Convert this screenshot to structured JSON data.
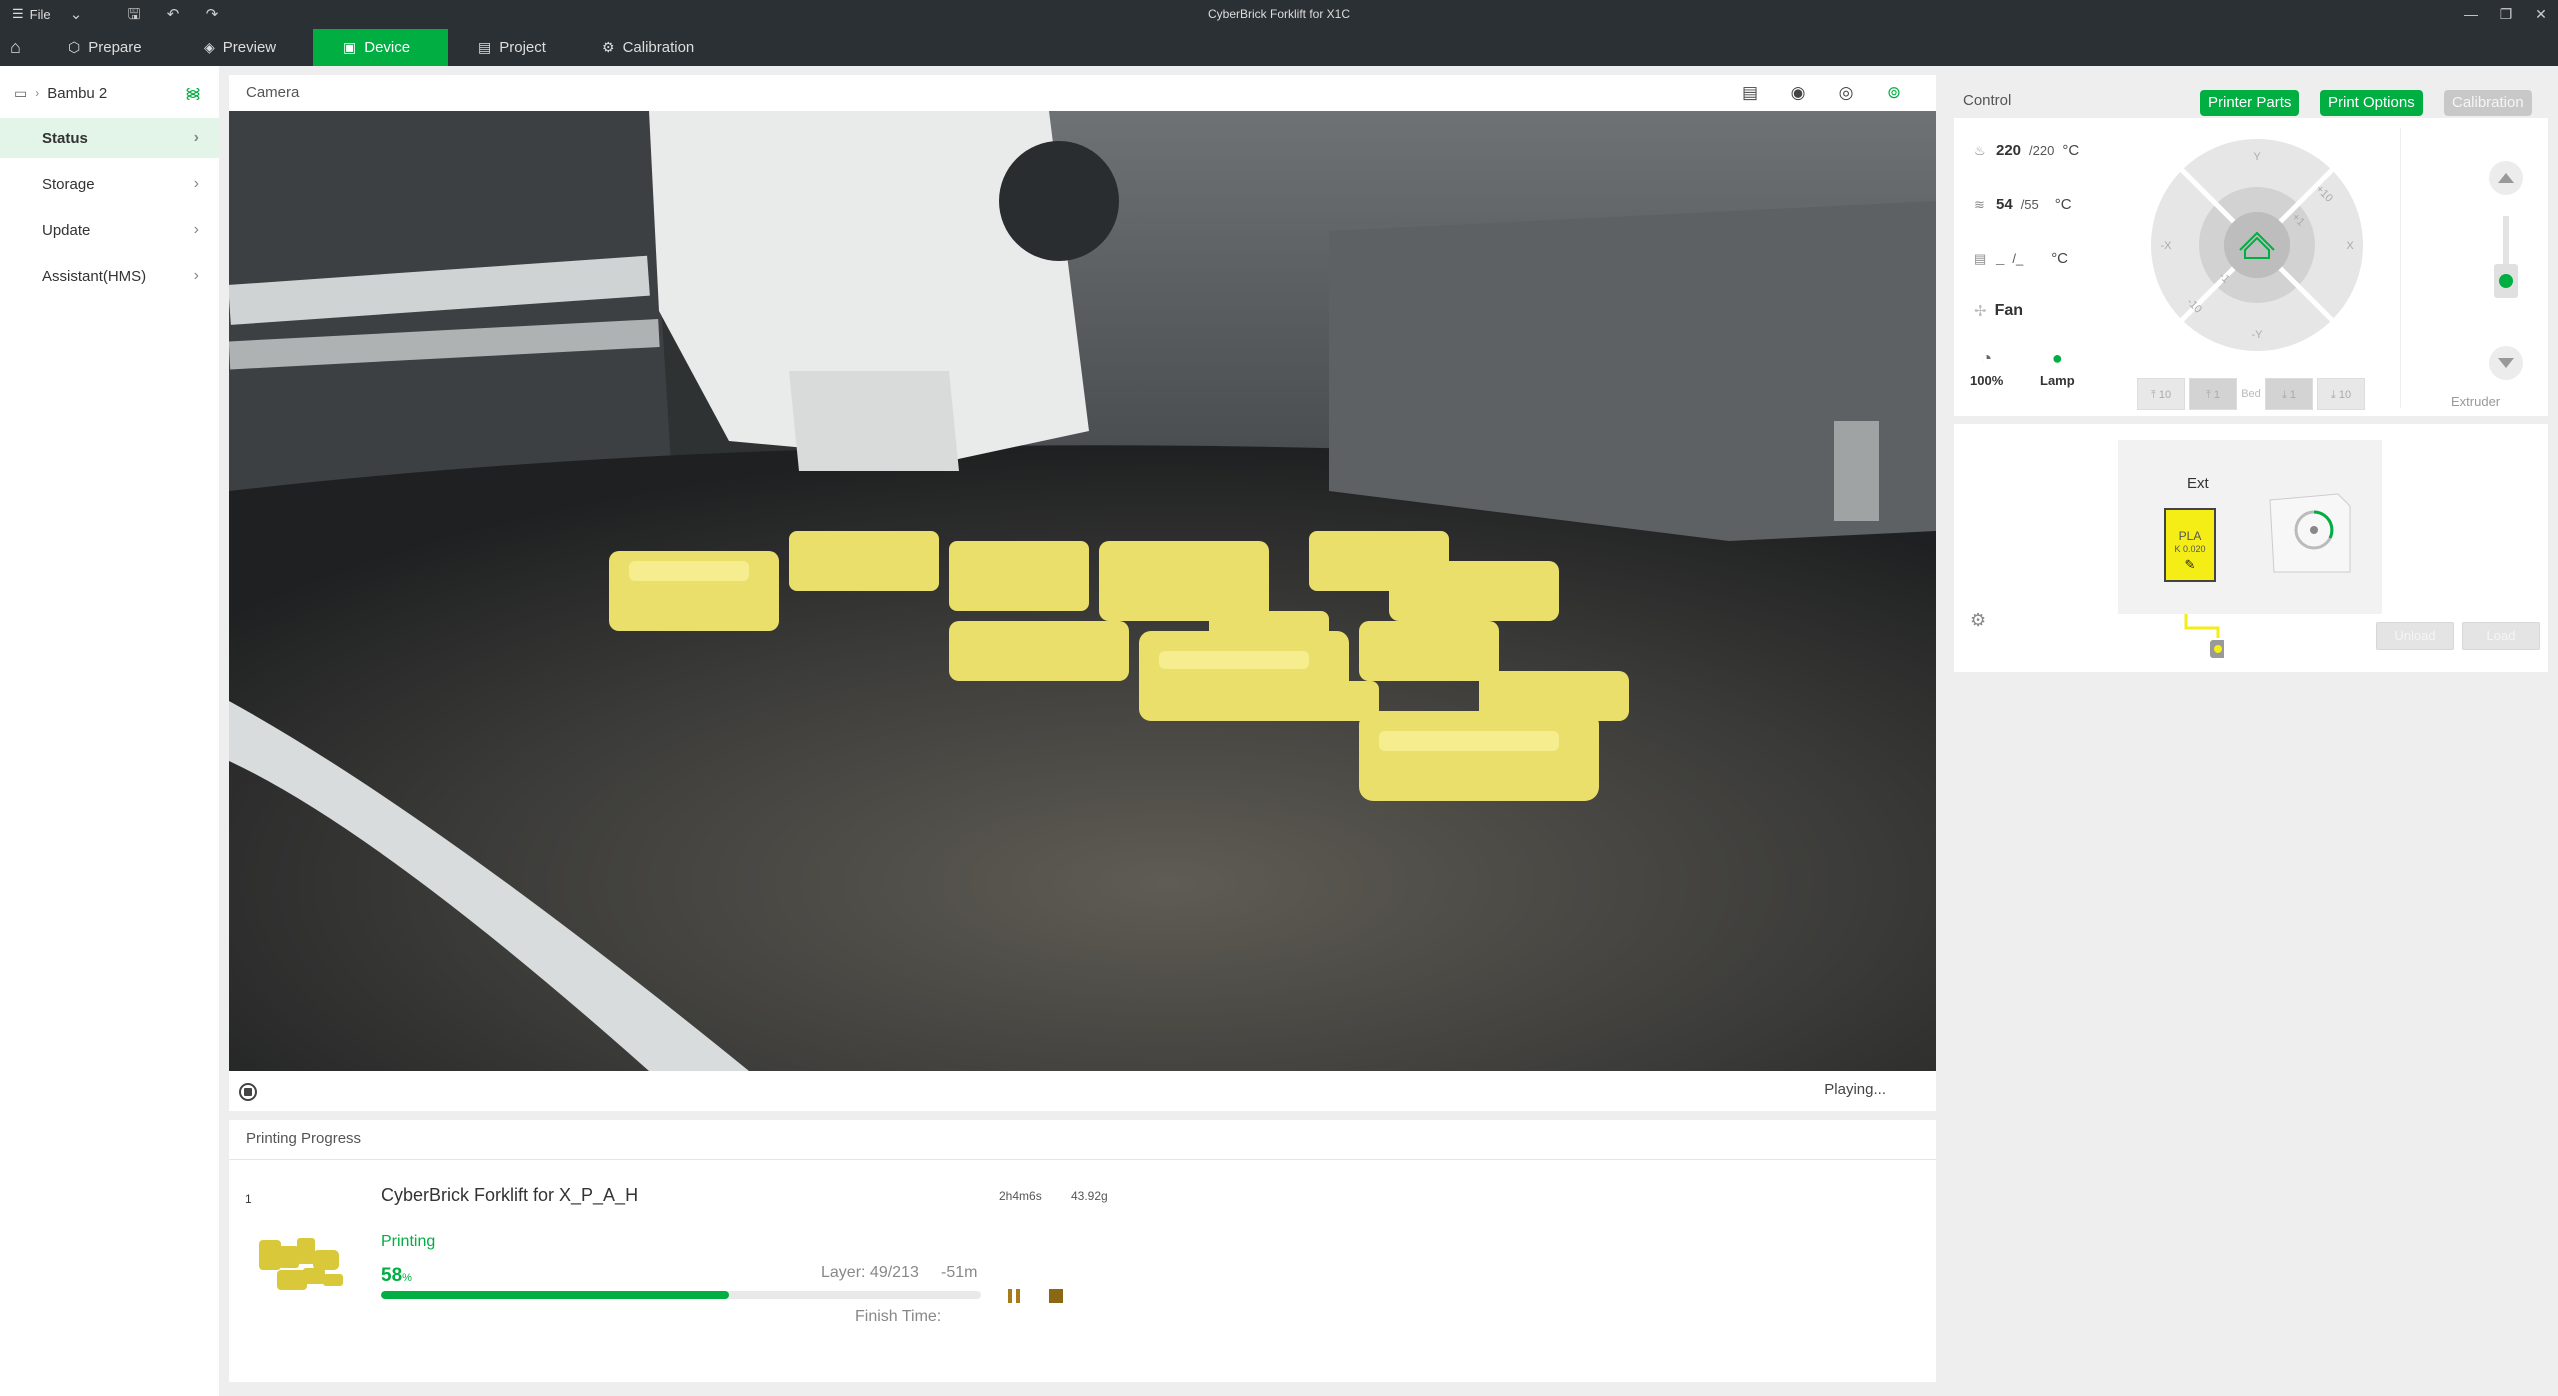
{
  "titlebar": {
    "file_label": "File",
    "window_title": "CyberBrick Forklift for X1C"
  },
  "tabs": [
    {
      "label": "Prepare",
      "icon": "cube-icon"
    },
    {
      "label": "Preview",
      "icon": "layers-icon"
    },
    {
      "label": "Device",
      "icon": "device-icon",
      "active": true
    },
    {
      "label": "Project",
      "icon": "project-icon"
    },
    {
      "label": "Calibration",
      "icon": "calibration-icon"
    }
  ],
  "sidebar": {
    "device_name": "Bambu 2",
    "items": [
      {
        "label": "Status",
        "active": true
      },
      {
        "label": "Storage"
      },
      {
        "label": "Update"
      },
      {
        "label": "Assistant(HMS)"
      }
    ]
  },
  "camera": {
    "title": "Camera",
    "status": "Playing..."
  },
  "progress": {
    "title": "Printing Progress",
    "plate_number": "1",
    "job_name": "CyberBrick Forklift for X_P_A_H",
    "time": "2h4m6s",
    "weight": "43.92g",
    "status": "Printing",
    "percent_value": "58",
    "percent_unit": "%",
    "fraction": 0.58,
    "layer": "Layer: 49/213",
    "remaining": "-51m",
    "finish_label": "Finish Time:"
  },
  "control": {
    "title": "Control",
    "buttons": {
      "parts": "Printer Parts",
      "options": "Print Options",
      "calibration": "Calibration"
    },
    "nozzle": {
      "current": "220",
      "target": "/220",
      "unit": "°C"
    },
    "bed": {
      "current": "54",
      "target": "/55",
      "unit": "°C"
    },
    "chamber": {
      "current": "_",
      "target": "/_",
      "unit": "°C"
    },
    "fan_label": "Fan",
    "speed_label": "100%",
    "lamp_label": "Lamp",
    "jog_labels": {
      "y": "Y",
      "neg_y": "-Y",
      "x": "X",
      "neg_x": "-X",
      "p10": "+10",
      "n10": "-10",
      "p1": "+1",
      "n1": "-1"
    },
    "bed_buttons": {
      "up10": "10",
      "up1": "1",
      "label": "Bed",
      "down1": "1",
      "down10": "10"
    },
    "extruder_label": "Extruder"
  },
  "ams": {
    "ext_label": "Ext",
    "slot_material": "PLA",
    "slot_k": "K 0.020",
    "slot_color": "#f4ee16",
    "unload_label": "Unload",
    "load_label": "Load"
  },
  "colors": {
    "accent": "#00ae42",
    "titlebar": "#2b3034"
  }
}
